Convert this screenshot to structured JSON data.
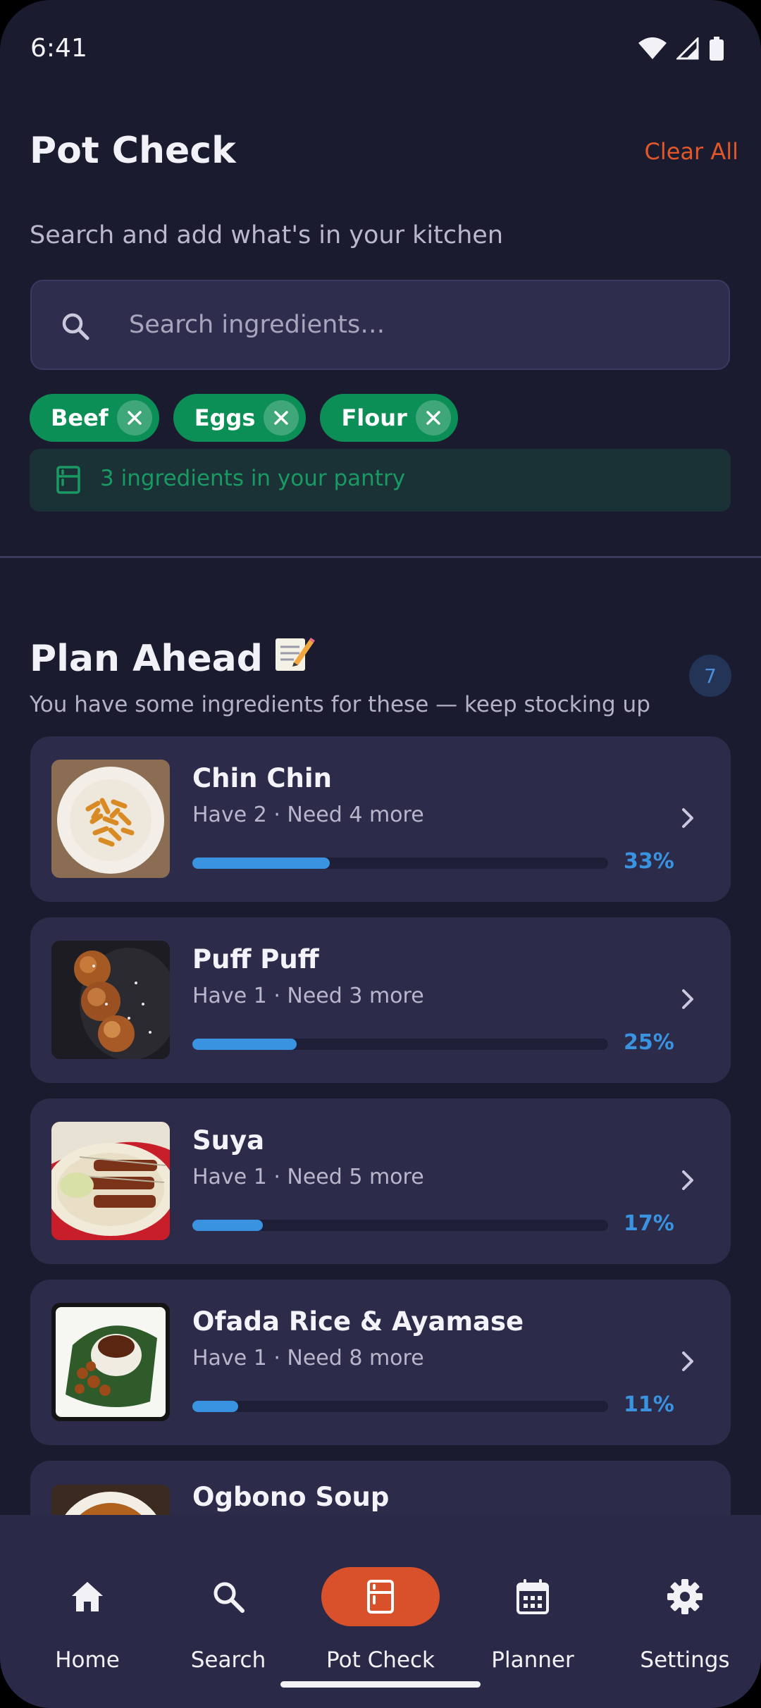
{
  "status_bar": {
    "time": "6:41"
  },
  "header": {
    "title": "Pot Check",
    "clear_all_label": "Clear All",
    "subtitle": "Search and add what's in your kitchen"
  },
  "search": {
    "placeholder": "Search ingredients…",
    "value": ""
  },
  "chips": [
    {
      "label": "Beef"
    },
    {
      "label": "Eggs"
    },
    {
      "label": "Flour"
    }
  ],
  "pantry_banner": {
    "text": "3 ingredients in your pantry"
  },
  "plan_ahead": {
    "title": "Plan Ahead",
    "emoji": "📝",
    "count": "7",
    "subtitle": "You have some ingredients for these — keep stocking up",
    "recipes": [
      {
        "name": "Chin Chin",
        "meta": "Have 2 · Need 4 more",
        "percent_label": "33%",
        "progress": 0.33
      },
      {
        "name": "Puff Puff",
        "meta": "Have 1 · Need 3 more",
        "percent_label": "25%",
        "progress": 0.25
      },
      {
        "name": "Suya",
        "meta": "Have 1 · Need 5 more",
        "percent_label": "17%",
        "progress": 0.17
      },
      {
        "name": "Ofada Rice & Ayamase",
        "meta": "Have 1 · Need 8 more",
        "percent_label": "11%",
        "progress": 0.11
      },
      {
        "name": "Ogbono Soup"
      }
    ]
  },
  "bottom_nav": {
    "items": [
      {
        "label": "Home",
        "icon": "home-icon"
      },
      {
        "label": "Search",
        "icon": "search-icon"
      },
      {
        "label": "Pot Check",
        "icon": "fridge-icon",
        "active": true
      },
      {
        "label": "Planner",
        "icon": "calendar-icon"
      },
      {
        "label": "Settings",
        "icon": "gear-icon"
      }
    ]
  },
  "colors": {
    "background": "#1b1b2f",
    "card": "#2c2b4a",
    "accent_orange": "#d8512a",
    "accent_green": "#0b8f56",
    "progress_blue": "#3a93e0"
  }
}
